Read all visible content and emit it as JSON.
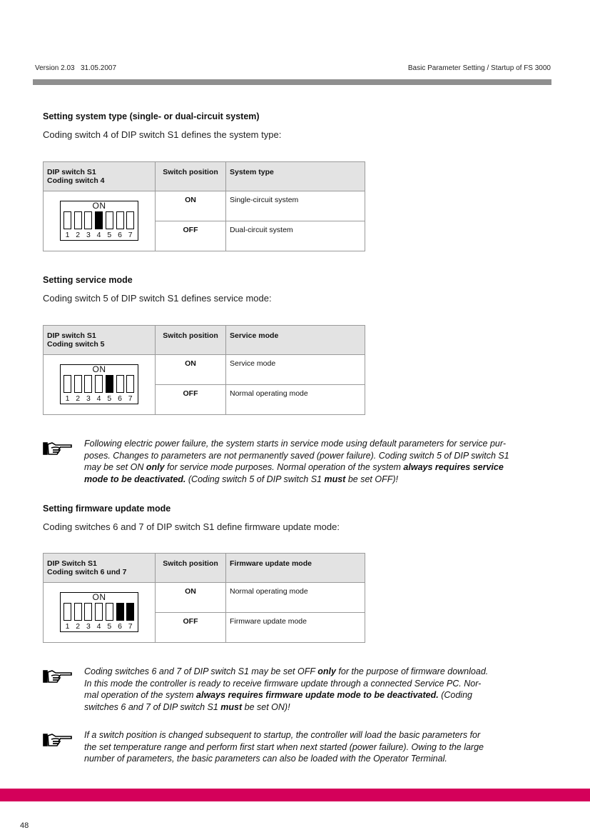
{
  "header": {
    "version": "Version 2.03",
    "date": "31.05.2007",
    "title": "Basic Parameter Setting / Startup of FS 3000"
  },
  "sections": [
    {
      "heading": "Setting system type (single- or dual-circuit system)",
      "intro": "Coding switch 4 of DIP switch S1 defines the system type:",
      "table": {
        "col1_line1": "DIP switch S1",
        "col1_line2": "Coding switch 4",
        "col2": "Switch position",
        "col3": "System type",
        "diagram": {
          "label": "ON",
          "numbers": [
            "1",
            "2",
            "3",
            "4",
            "5",
            "6",
            "7"
          ],
          "active": [
            4
          ]
        },
        "rows": [
          {
            "position": "ON",
            "value": "Single-circuit system"
          },
          {
            "position": "OFF",
            "value": "Dual-circuit system"
          }
        ]
      }
    },
    {
      "heading": "Setting service mode",
      "intro": "Coding switch 5 of DIP switch S1 defines service mode:",
      "table": {
        "col1_line1": "DIP switch S1",
        "col1_line2": "Coding switch 5",
        "col2": "Switch position",
        "col3": "Service mode",
        "diagram": {
          "label": "ON",
          "numbers": [
            "1",
            "2",
            "3",
            "4",
            "5",
            "6",
            "7"
          ],
          "active": [
            5
          ]
        },
        "rows": [
          {
            "position": "ON",
            "value": "Service mode"
          },
          {
            "position": "OFF",
            "value": "Normal operating mode"
          }
        ]
      }
    },
    {
      "heading": "Setting firmware update mode",
      "intro": "Coding switches 6 and 7 of DIP switch S1 define firmware update mode:",
      "table": {
        "col1_line1": "DIP Switch S1",
        "col1_line2": "Coding switch 6 und 7",
        "col2": "Switch position",
        "col3": "Firmware update mode",
        "diagram": {
          "label": "ON",
          "numbers": [
            "1",
            "2",
            "3",
            "4",
            "5",
            "6",
            "7"
          ],
          "active": [
            6,
            7
          ]
        },
        "rows": [
          {
            "position": "ON",
            "value": "Normal operating mode"
          },
          {
            "position": "OFF",
            "value": "Firmware update mode"
          }
        ]
      }
    }
  ],
  "notes": [
    {
      "icon": "pointing-hand-icon",
      "parts": [
        {
          "t": "Following electric power failure, the system starts in service mode using default parameters for service pur-\nposes. Changes to parameters are not permanently saved (power failure). Coding switch 5 of DIP switch S1\nmay be set ON ",
          "b": false
        },
        {
          "t": "only",
          "b": true
        },
        {
          "t": " for service mode purposes. Normal operation of the system ",
          "b": false
        },
        {
          "t": "always requires service\nmode to be deactivated.",
          "b": true
        },
        {
          "t": " (Coding switch 5 of DIP switch S1 ",
          "b": false
        },
        {
          "t": "must",
          "b": true
        },
        {
          "t": " be set OFF)!",
          "b": false
        }
      ]
    },
    {
      "icon": "pointing-hand-icon",
      "parts": [
        {
          "t": "Coding switches 6 and 7 of DIP switch S1 may be set OFF ",
          "b": false
        },
        {
          "t": "only",
          "b": true
        },
        {
          "t": " for the purpose of firmware download.\nIn this mode the controller is ready to receive firmware update through a connected Service PC. Nor-\nmal operation of the system ",
          "b": false
        },
        {
          "t": "always requires firmware update mode to be deactivated.",
          "b": true
        },
        {
          "t": " (Coding\nswitches 6 and 7 of DIP switch S1 ",
          "b": false
        },
        {
          "t": "must",
          "b": true
        },
        {
          "t": " be set ON)!",
          "b": false
        }
      ]
    },
    {
      "icon": "pointing-hand-icon",
      "parts": [
        {
          "t": "If a switch position is changed subsequent to startup, the controller will load the basic parameters for\nthe set temperature range and perform first start when next started (power failure). Owing to the large\nnumber of parameters, the basic parameters can also be loaded with the Operator Terminal.",
          "b": false
        }
      ]
    }
  ],
  "footer": {
    "page_number": "48",
    "accent_color": "#d4005a"
  }
}
